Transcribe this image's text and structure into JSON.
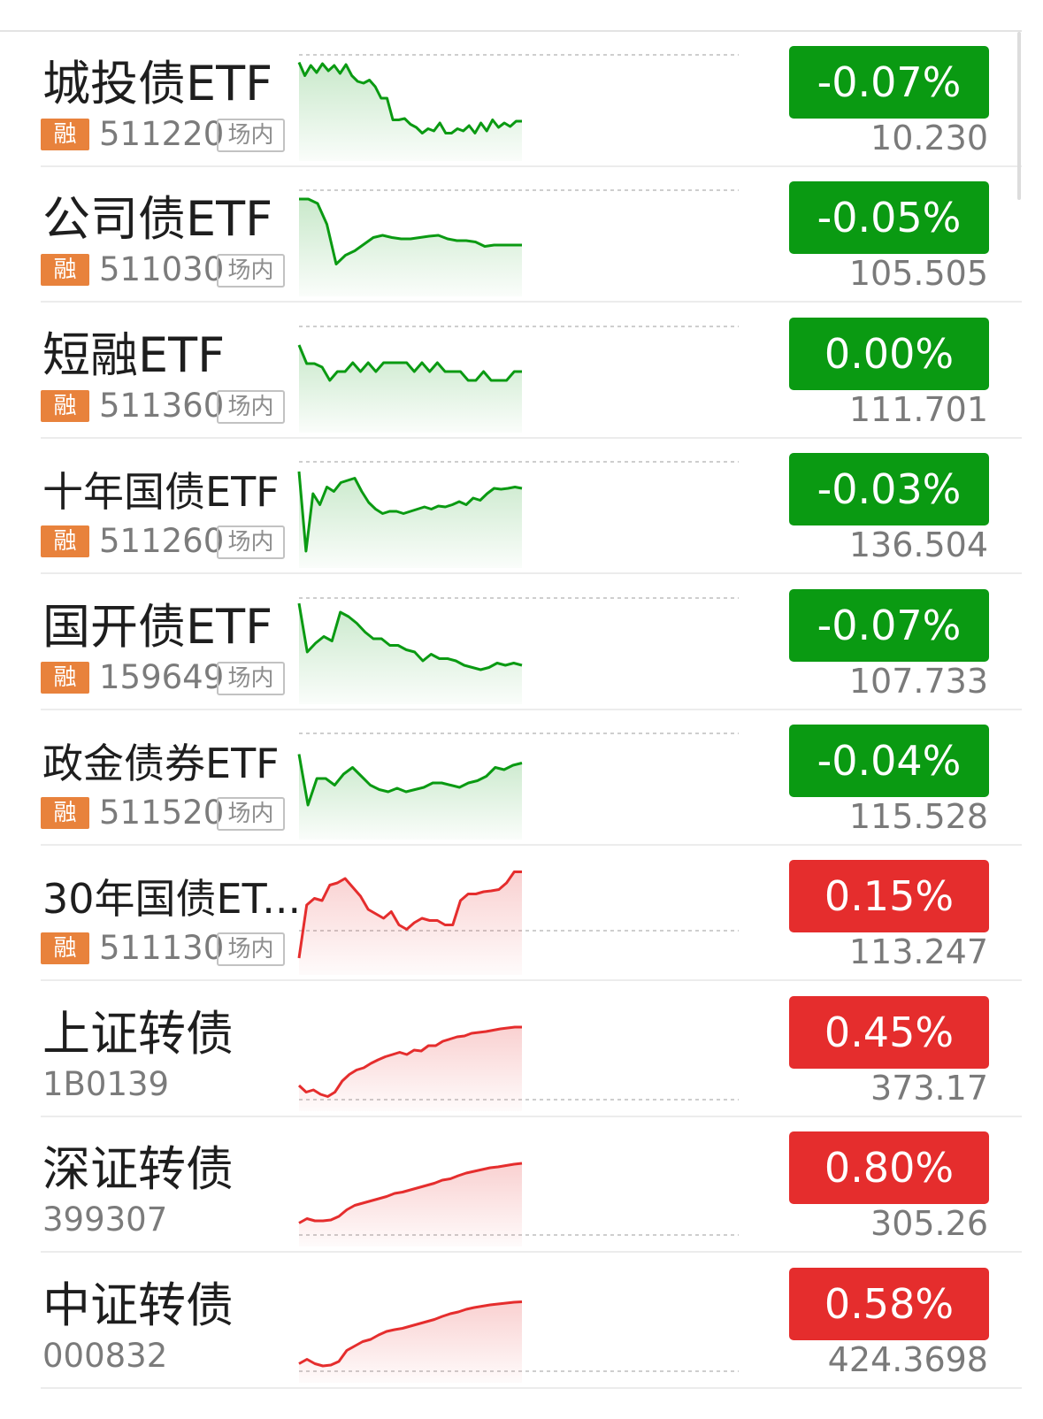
{
  "colors": {
    "up": "#e52d2d",
    "down": "#0a9a12",
    "rong_tag": "#e8823c"
  },
  "rows": [
    {
      "name": "城投债ETF",
      "rong": "融",
      "code": "511220",
      "venue": "场内",
      "change": "-0.07%",
      "price": "10.230",
      "trend": "down",
      "spark": [
        0.85,
        0.55,
        0.78,
        0.62,
        0.82,
        0.66,
        0.78,
        0.6,
        0.8,
        0.55,
        0.42,
        0.38,
        0.45,
        0.3,
        0.04,
        0.04,
        -0.45,
        -0.45,
        -0.42,
        -0.55,
        -0.62,
        -0.75,
        -0.65,
        -0.7,
        -0.52,
        -0.75,
        -0.75,
        -0.65,
        -0.7,
        -0.58,
        -0.75,
        -0.52,
        -0.7,
        -0.45,
        -0.62,
        -0.52,
        -0.6,
        -0.48,
        -0.48
      ]
    },
    {
      "name": "公司债ETF",
      "rong": "融",
      "code": "511030",
      "venue": "场内",
      "change": "-0.05%",
      "price": "105.505",
      "trend": "down",
      "spark": [
        0.82,
        0.82,
        0.72,
        0.25,
        -0.65,
        -0.45,
        -0.35,
        -0.2,
        -0.05,
        0.0,
        -0.05,
        -0.08,
        -0.08,
        -0.05,
        -0.02,
        0.0,
        -0.08,
        -0.12,
        -0.12,
        -0.15,
        -0.25,
        -0.22,
        -0.22,
        -0.22,
        -0.22
      ]
    },
    {
      "name": "短融ETF",
      "rong": "融",
      "code": "511360",
      "venue": "场内",
      "change": "0.00%",
      "price": "111.701",
      "trend": "down",
      "spark": [
        0.6,
        0.18,
        0.18,
        0.1,
        -0.2,
        0.0,
        0.0,
        0.2,
        0.0,
        0.2,
        0.0,
        0.2,
        0.2,
        0.2,
        0.2,
        0.0,
        0.2,
        0.0,
        0.2,
        0.0,
        0.0,
        0.0,
        -0.2,
        -0.2,
        0.0,
        -0.2,
        -0.2,
        -0.2,
        0.0,
        0.0
      ]
    },
    {
      "name": "十年国债ETF",
      "rong": "融",
      "code": "511260",
      "venue": "场内",
      "change": "-0.03%",
      "price": "136.504",
      "trend": "down",
      "spark": [
        0.8,
        -1.0,
        0.3,
        0.05,
        0.45,
        0.35,
        0.55,
        0.6,
        0.65,
        0.35,
        0.1,
        -0.05,
        -0.15,
        -0.1,
        -0.1,
        -0.15,
        -0.1,
        -0.05,
        0.0,
        -0.05,
        0.02,
        0.0,
        0.05,
        0.12,
        0.05,
        0.2,
        0.15,
        0.3,
        0.42,
        0.4,
        0.42,
        0.45,
        0.42
      ]
    },
    {
      "name": "国开债ETF",
      "rong": "融",
      "code": "159649",
      "venue": "场内",
      "change": "-0.07%",
      "price": "107.733",
      "trend": "down",
      "spark": [
        0.9,
        -0.2,
        0.0,
        0.15,
        0.05,
        0.7,
        0.6,
        0.45,
        0.25,
        0.1,
        0.1,
        -0.05,
        -0.05,
        -0.15,
        -0.2,
        -0.4,
        -0.25,
        -0.35,
        -0.35,
        -0.4,
        -0.5,
        -0.55,
        -0.6,
        -0.55,
        -0.45,
        -0.5,
        -0.45,
        -0.5
      ]
    },
    {
      "name": "政金债券ETF",
      "rong": "融",
      "code": "511520",
      "venue": "场内",
      "change": "-0.04%",
      "price": "115.528",
      "trend": "down",
      "spark": [
        0.55,
        -0.6,
        0.0,
        0.0,
        -0.15,
        0.1,
        0.25,
        0.05,
        -0.15,
        -0.25,
        -0.3,
        -0.22,
        -0.3,
        -0.25,
        -0.2,
        -0.1,
        -0.1,
        -0.15,
        -0.2,
        -0.1,
        -0.05,
        0.05,
        0.25,
        0.2,
        0.3,
        0.35
      ]
    },
    {
      "name": "30年国债ET...",
      "rong": "融",
      "code": "511130",
      "venue": "场内",
      "change": "0.15%",
      "price": "113.247",
      "trend": "up",
      "spark": [
        -1.0,
        0.2,
        0.35,
        0.3,
        0.65,
        0.7,
        0.8,
        0.6,
        0.4,
        0.1,
        0.0,
        -0.1,
        0.05,
        -0.25,
        -0.35,
        -0.2,
        -0.1,
        -0.15,
        -0.15,
        -0.25,
        -0.25,
        0.3,
        0.45,
        0.45,
        0.5,
        0.52,
        0.55,
        0.7,
        0.95,
        0.95
      ]
    },
    {
      "name": "上证转债",
      "rong": "",
      "code": "1B0139",
      "venue": "",
      "change": "0.45%",
      "price": "373.17",
      "trend": "up",
      "spark": [
        -0.8,
        -0.95,
        -0.9,
        -1.0,
        -1.05,
        -0.95,
        -0.7,
        -0.55,
        -0.45,
        -0.4,
        -0.3,
        -0.22,
        -0.15,
        -0.1,
        -0.05,
        -0.1,
        0.0,
        -0.02,
        0.1,
        0.1,
        0.2,
        0.25,
        0.3,
        0.32,
        0.38,
        0.4,
        0.42,
        0.45,
        0.48,
        0.5,
        0.52,
        0.52
      ]
    },
    {
      "name": "深证转债",
      "rong": "",
      "code": "399307",
      "venue": "",
      "change": "0.80%",
      "price": "305.26",
      "trend": "up",
      "spark": [
        -0.85,
        -0.75,
        -0.8,
        -0.8,
        -0.78,
        -0.7,
        -0.55,
        -0.45,
        -0.4,
        -0.35,
        -0.3,
        -0.25,
        -0.18,
        -0.15,
        -0.1,
        -0.05,
        0.0,
        0.05,
        0.12,
        0.15,
        0.22,
        0.28,
        0.32,
        0.36,
        0.4,
        0.42,
        0.45,
        0.48,
        0.5
      ]
    },
    {
      "name": "中证转债",
      "rong": "",
      "code": "000832",
      "venue": "",
      "change": "0.58%",
      "price": "424.3698",
      "trend": "up",
      "spark": [
        -0.95,
        -0.85,
        -0.95,
        -1.0,
        -0.98,
        -0.9,
        -0.65,
        -0.55,
        -0.45,
        -0.4,
        -0.3,
        -0.22,
        -0.18,
        -0.15,
        -0.1,
        -0.05,
        0.0,
        0.05,
        0.12,
        0.18,
        0.22,
        0.28,
        0.32,
        0.35,
        0.38,
        0.4,
        0.42,
        0.44,
        0.45
      ]
    }
  ]
}
